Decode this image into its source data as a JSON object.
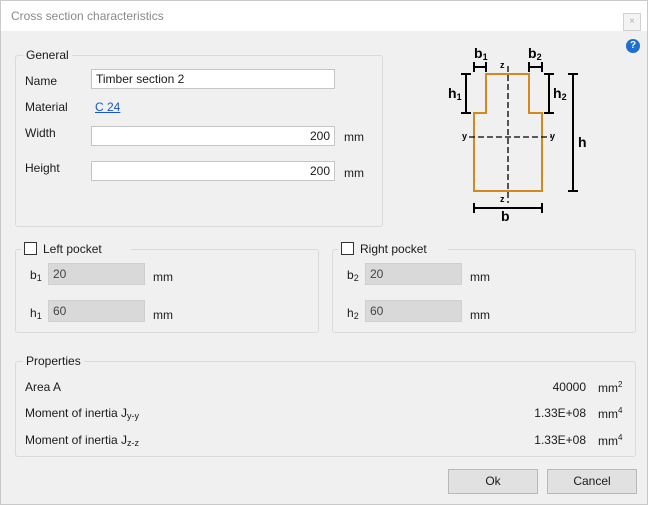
{
  "window": {
    "title": "Cross section characteristics",
    "close_glyph": "×",
    "help_glyph": "?"
  },
  "general": {
    "legend": "General",
    "name_label": "Name",
    "name_value": "Timber section 2",
    "material_label": "Material",
    "material_value": "C 24",
    "width_label": "Width",
    "width_value": "200",
    "width_unit": "mm",
    "height_label": "Height",
    "height_value": "200",
    "height_unit": "mm"
  },
  "diagram": {
    "b1": "b",
    "b1_sub": "1",
    "b2": "b",
    "b2_sub": "2",
    "h1": "h",
    "h1_sub": "1",
    "h2": "h",
    "h2_sub": "2",
    "h": "h",
    "b": "b",
    "y_left": "y",
    "y_right": "y",
    "z_top": "z",
    "z_bottom": "z",
    "section_color": "#d4891f"
  },
  "left_pocket": {
    "legend": "Left pocket",
    "checked": false,
    "b_label": "b",
    "b_sub": "1",
    "b_value": "20",
    "b_unit": "mm",
    "h_label": "h",
    "h_sub": "1",
    "h_value": "60",
    "h_unit": "mm"
  },
  "right_pocket": {
    "legend": "Right pocket",
    "checked": false,
    "b_label": "b",
    "b_sub": "2",
    "b_value": "20",
    "b_unit": "mm",
    "h_label": "h",
    "h_sub": "2",
    "h_value": "60",
    "h_unit": "mm"
  },
  "properties": {
    "legend": "Properties",
    "area_label": "Area A",
    "area_value": "40000",
    "area_unit": "mm",
    "area_unit_sup": "2",
    "iyy_label": "Moment of inertia J",
    "iyy_sub": "y-y",
    "iyy_value": "1.33E+08",
    "iyy_unit": "mm",
    "iyy_unit_sup": "4",
    "izz_label": "Moment of inertia J",
    "izz_sub": "z-z",
    "izz_value": "1.33E+08",
    "izz_unit": "mm",
    "izz_unit_sup": "4"
  },
  "buttons": {
    "ok": "Ok",
    "cancel": "Cancel"
  }
}
